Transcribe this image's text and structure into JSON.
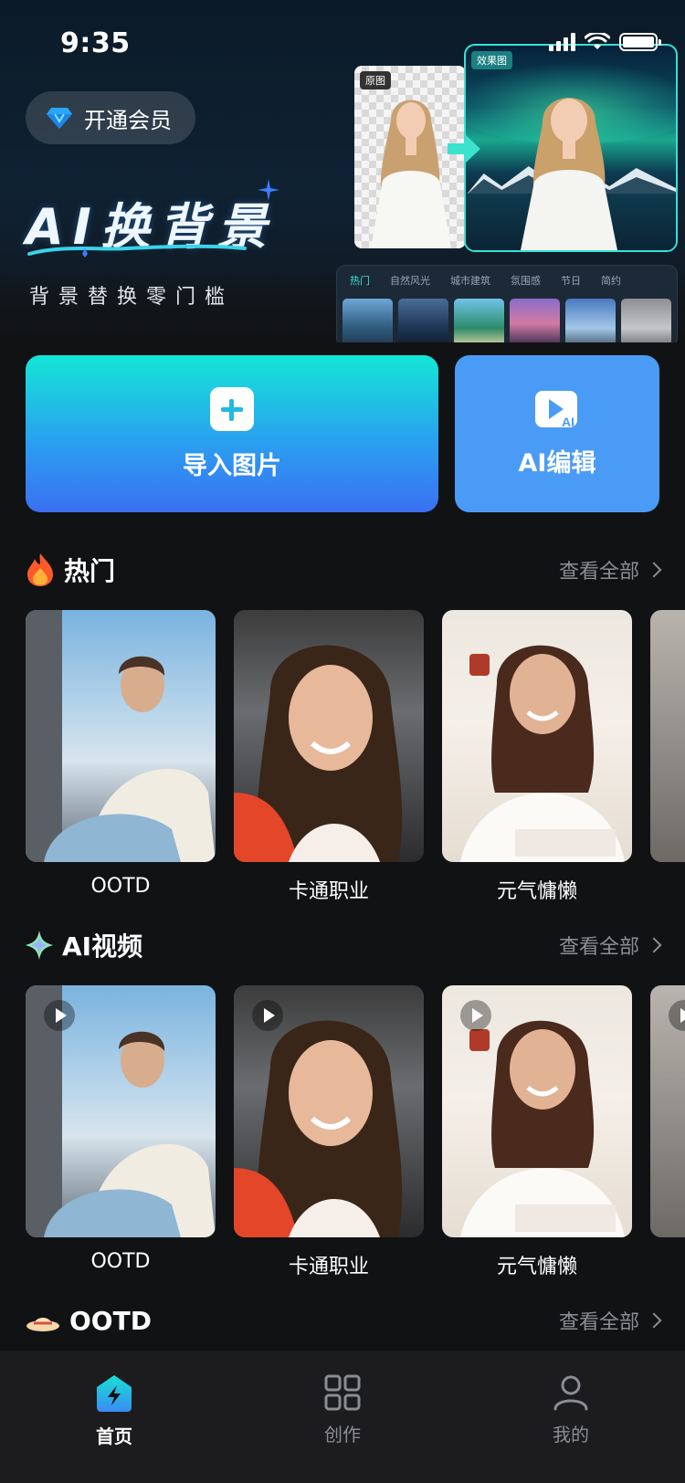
{
  "status": {
    "time": "9:35"
  },
  "hero": {
    "vip_label": "开通会员",
    "title": "AI换背景",
    "subtitle": "背景替换零门槛",
    "before_tag": "原图",
    "after_tag": "效果图",
    "filter_tabs": [
      "热门",
      "自然风光",
      "城市建筑",
      "氛围感",
      "节日",
      "简约"
    ]
  },
  "actions": {
    "import_label": "导入图片",
    "ai_edit_label": "AI编辑"
  },
  "sections": [
    {
      "title": "热门",
      "more": "查看全部",
      "items": [
        "OOTD",
        "卡通职业",
        "元气慵懒"
      ]
    },
    {
      "title": "AI视频",
      "more": "查看全部",
      "items": [
        "OOTD",
        "卡通职业",
        "元气慵懒"
      ]
    },
    {
      "title": "OOTD",
      "more": "查看全部",
      "items": []
    }
  ],
  "nav": {
    "items": [
      {
        "label": "首页",
        "active": true
      },
      {
        "label": "创作",
        "active": false
      },
      {
        "label": "我的",
        "active": false
      }
    ]
  },
  "colors": {
    "accent": "#14e6d6",
    "ai_button": "#4a9bf5",
    "background": "#111214"
  }
}
